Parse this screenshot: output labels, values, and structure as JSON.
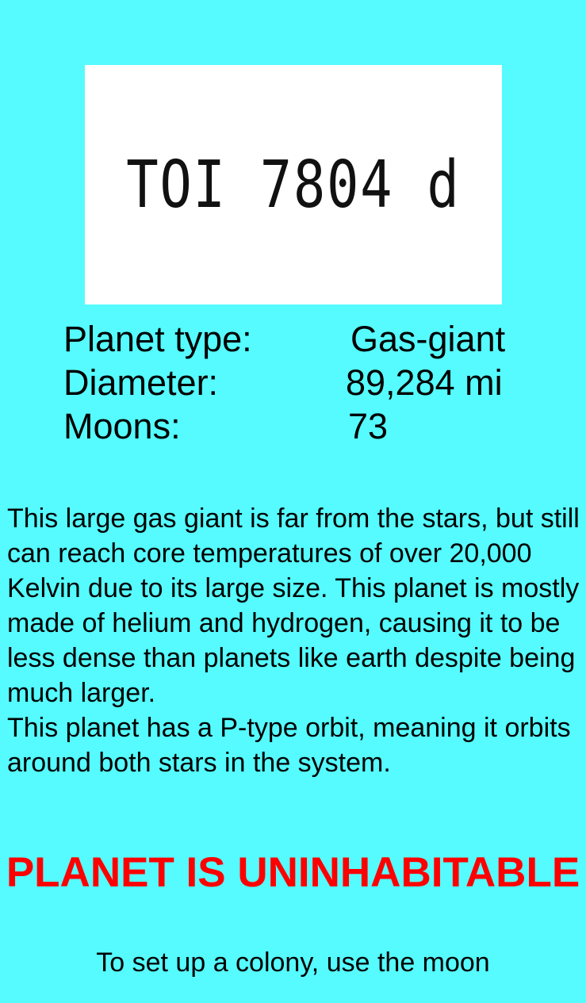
{
  "header": {
    "planet_name": "TOI 7804 d"
  },
  "stats": {
    "planet_type": {
      "label": "Planet type:",
      "value": "Gas-giant"
    },
    "diameter": {
      "label": "Diameter:",
      "value": "89,284 mi"
    },
    "moons": {
      "label": "Moons:",
      "value": "73"
    }
  },
  "description": {
    "paragraph_1": "This large gas giant is far from the stars, but still can reach core temperatures of over 20,000 Kelvin due to its large size. This planet is mostly made of helium and hydrogen, causing it to be less dense than planets like earth despite being much larger.",
    "paragraph_2": "This planet has a P-type orbit, meaning it orbits around both stars in the system."
  },
  "habitability": {
    "status": "PLANET IS UNINHABITABLE",
    "note": "To set up a colony, use the moon"
  },
  "colors": {
    "background": "#55fbff",
    "warning": "#ff0000",
    "title_box": "#ffffff"
  }
}
